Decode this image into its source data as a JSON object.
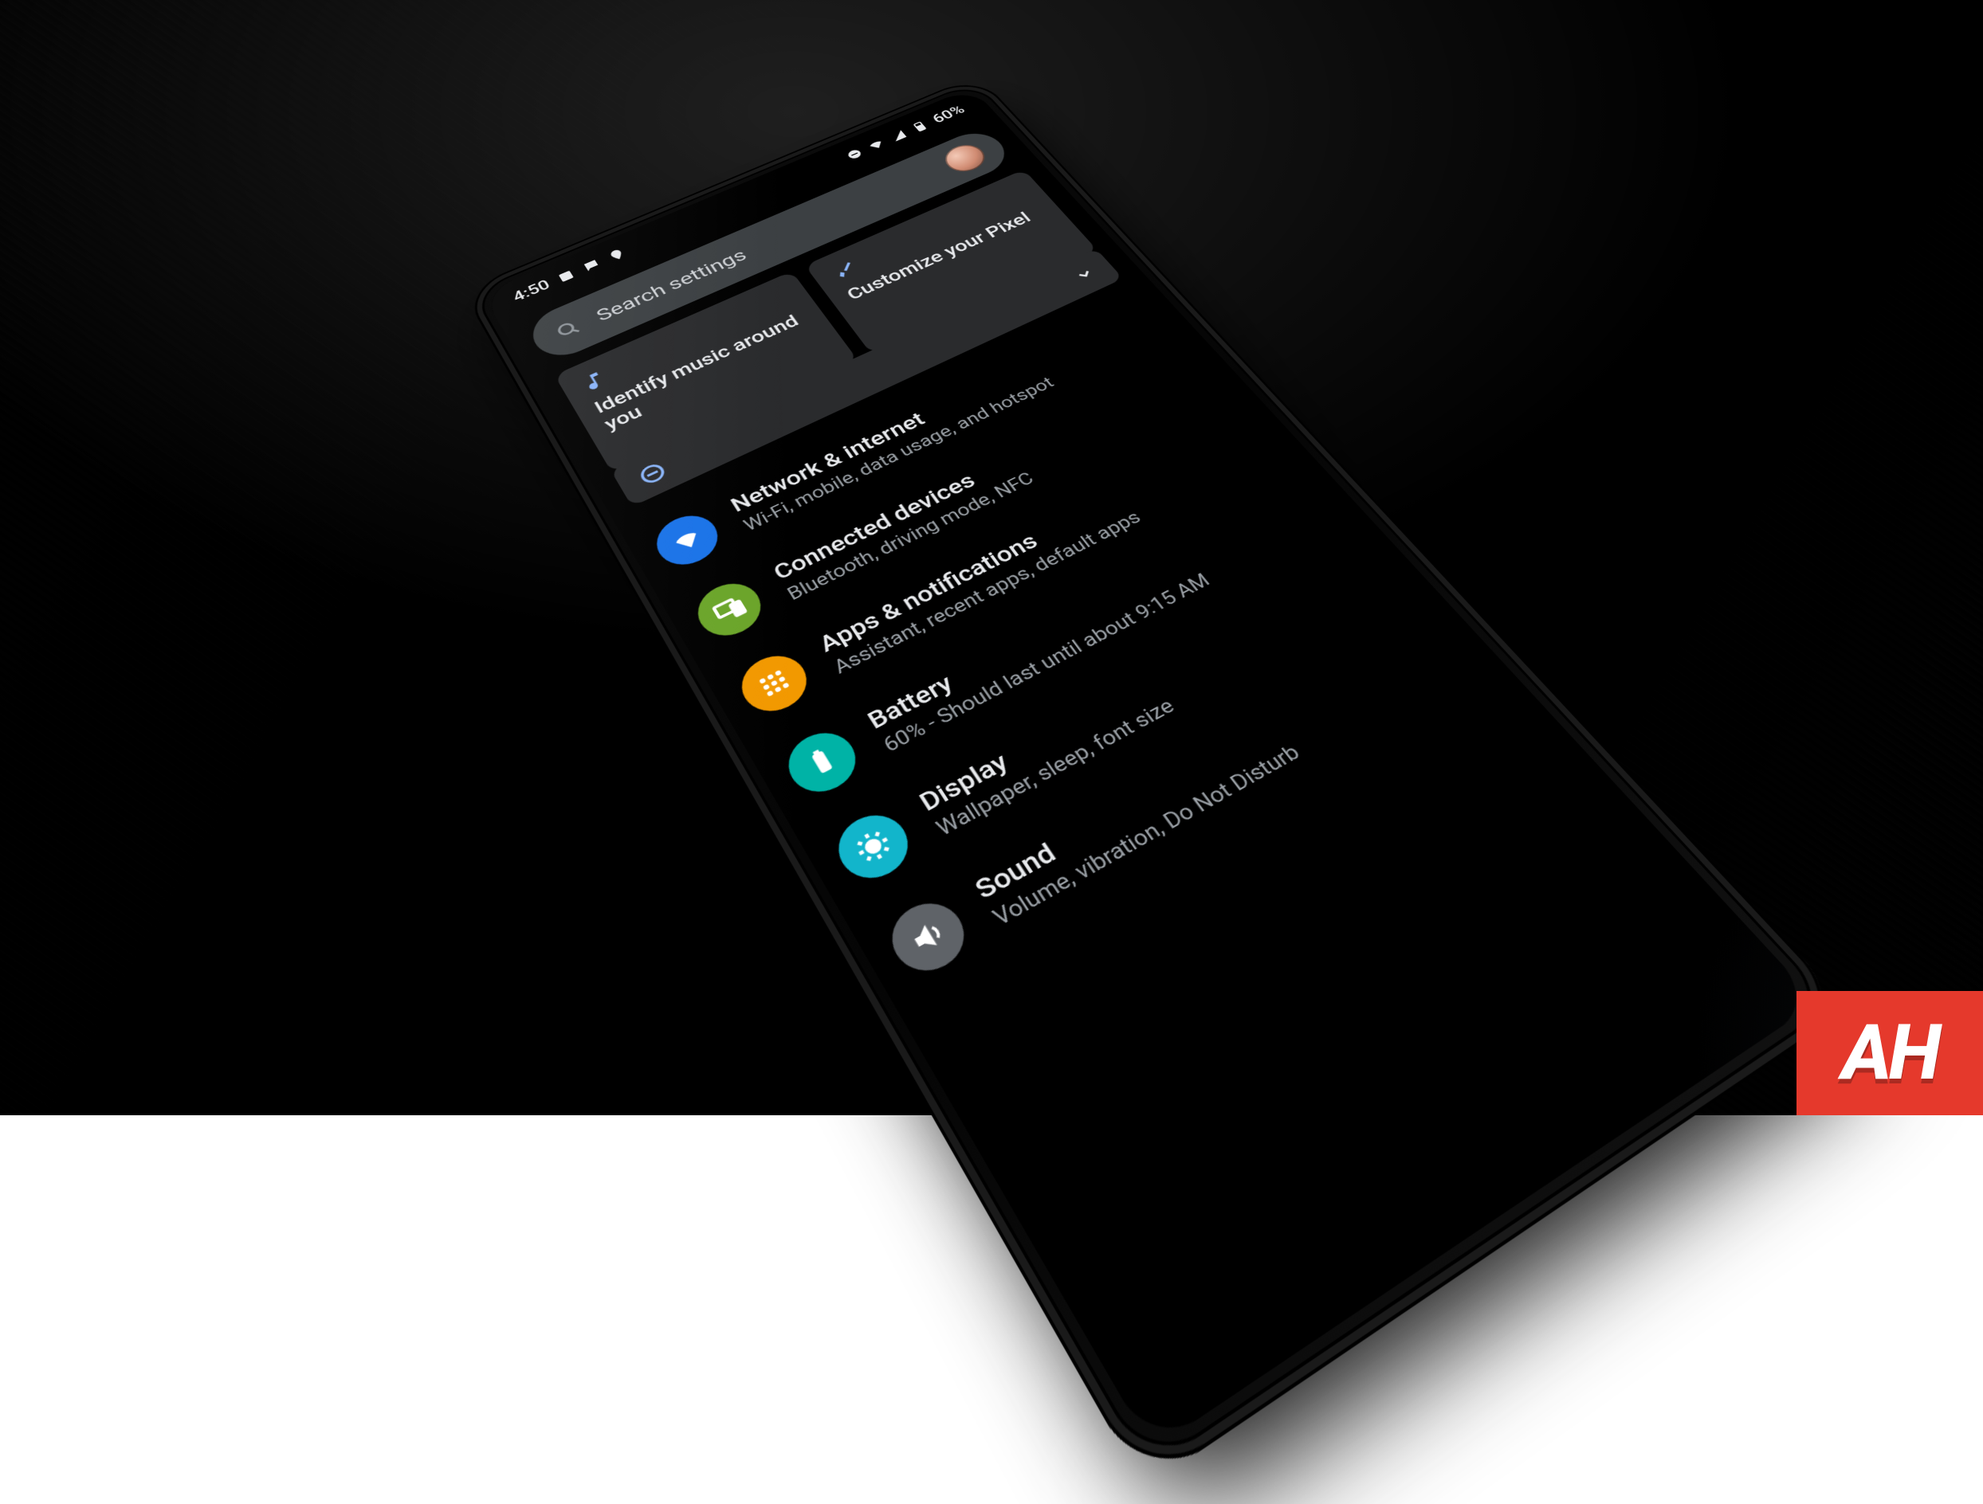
{
  "watermark": {
    "text": "AH"
  },
  "status": {
    "time": "4:50",
    "battery_label": "60%"
  },
  "search": {
    "placeholder": "Search settings"
  },
  "cards": [
    {
      "icon": "music-note-icon",
      "label": "Identify music around you"
    },
    {
      "icon": "brush-icon",
      "label": "Customize your Pixel"
    }
  ],
  "list": [
    {
      "icon": "wifi-icon",
      "color": "c-blue",
      "title": "Network & internet",
      "subtitle": "Wi-Fi, mobile, data usage, and hotspot"
    },
    {
      "icon": "devices-icon",
      "color": "c-olive",
      "title": "Connected devices",
      "subtitle": "Bluetooth, driving mode, NFC"
    },
    {
      "icon": "apps-icon",
      "color": "c-orange",
      "title": "Apps & notifications",
      "subtitle": "Assistant, recent apps, default apps"
    },
    {
      "icon": "battery-icon",
      "color": "c-teal",
      "title": "Battery",
      "subtitle": "60% - Should last until about 9:15 AM"
    },
    {
      "icon": "display-icon",
      "color": "c-tealL",
      "title": "Display",
      "subtitle": "Wallpaper, sleep, font size"
    },
    {
      "icon": "sound-icon",
      "color": "c-grey",
      "title": "Sound",
      "subtitle": "Volume, vibration, Do Not Disturb"
    }
  ]
}
